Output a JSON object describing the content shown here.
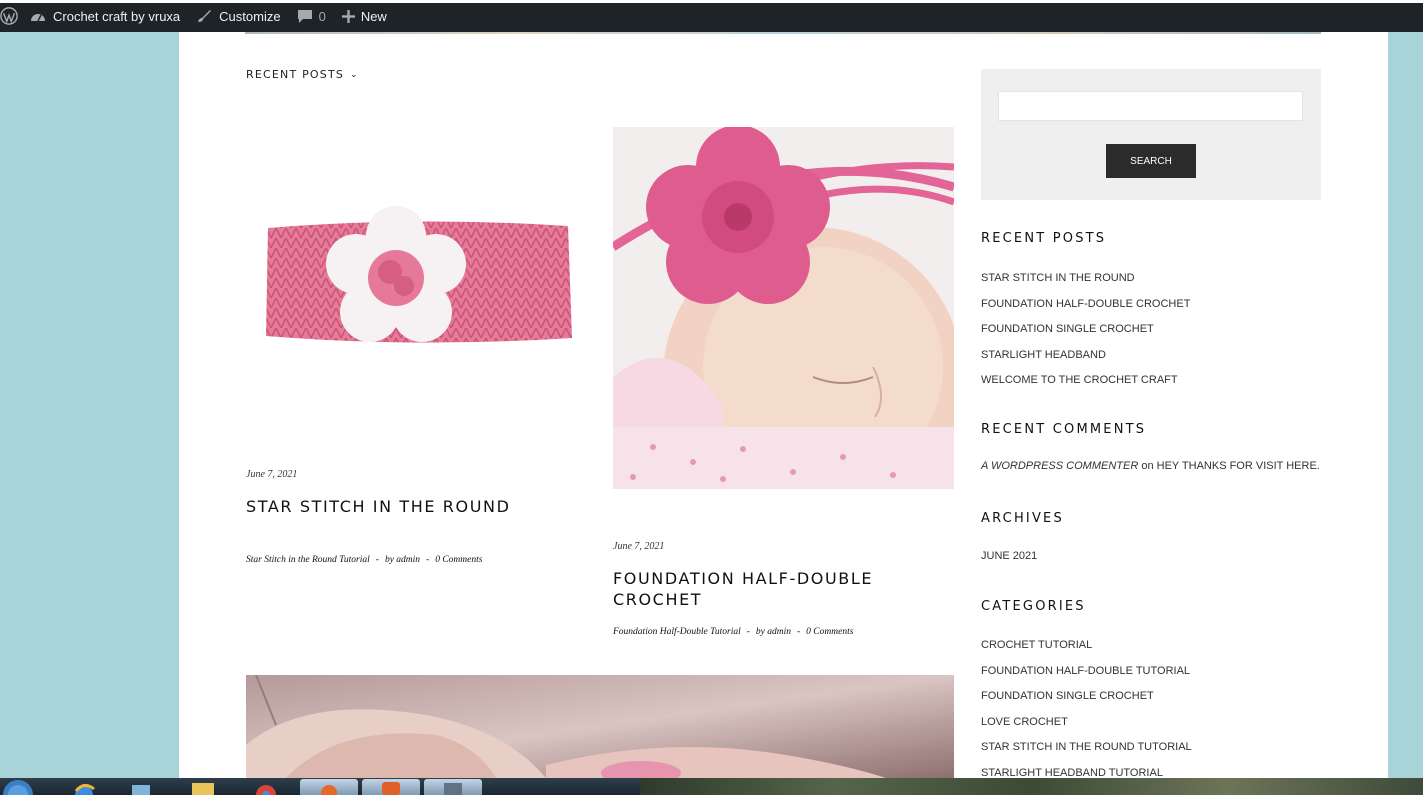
{
  "admin_bar": {
    "site_name": "Crochet craft by vruxa",
    "customize": "Customize",
    "comments_count": "0",
    "new": "New"
  },
  "nav": {
    "recent_posts_menu": "RECENT POSTS",
    "chevron": "⌄"
  },
  "posts": [
    {
      "date": "June 7, 2021",
      "title": "STAR STITCH IN THE ROUND",
      "category": "Star Stitch in the Round Tutorial",
      "author": "by admin",
      "comments": "0 Comments",
      "image": "pink-knit-headband-with-white-flower"
    },
    {
      "date": "June 7, 2021",
      "title": "FOUNDATION HALF-DOUBLE CROCHET",
      "category": "Foundation Half-Double Tutorial",
      "author": "by admin",
      "comments": "0 Comments",
      "image": "baby-with-pink-crochet-flower-headband"
    },
    {
      "image": "hands-crocheting-pink-yarn"
    }
  ],
  "meta_separator": "-",
  "sidebar": {
    "search_button": "SEARCH",
    "search_placeholder": "",
    "recent_posts_title": "RECENT POSTS",
    "recent_posts": [
      "STAR STITCH IN THE ROUND",
      "FOUNDATION HALF-DOUBLE CROCHET",
      "FOUNDATION SINGLE CROCHET",
      "STARLIGHT HEADBAND",
      "WELCOME TO THE CROCHET CRAFT"
    ],
    "recent_comments_title": "RECENT COMMENTS",
    "comment_author": "A WORDPRESS COMMENTER",
    "comment_on": "on",
    "comment_post": "HEY THANKS FOR VISIT HERE.",
    "archives_title": "ARCHIVES",
    "archives": [
      "JUNE 2021"
    ],
    "categories_title": "CATEGORIES",
    "categories": [
      "CROCHET TUTORIAL",
      "FOUNDATION HALF-DOUBLE TUTORIAL",
      "FOUNDATION SINGLE CROCHET",
      "LOVE CROCHET",
      "STAR STITCH IN THE ROUND TUTORIAL",
      "STARLIGHT HEADBAND TUTORIAL"
    ]
  },
  "colors": {
    "page_bg": "#a8d3d9",
    "admin_bar": "#1d2327",
    "search_button": "#2b2b2b",
    "accent_pink": "#e0608f"
  }
}
